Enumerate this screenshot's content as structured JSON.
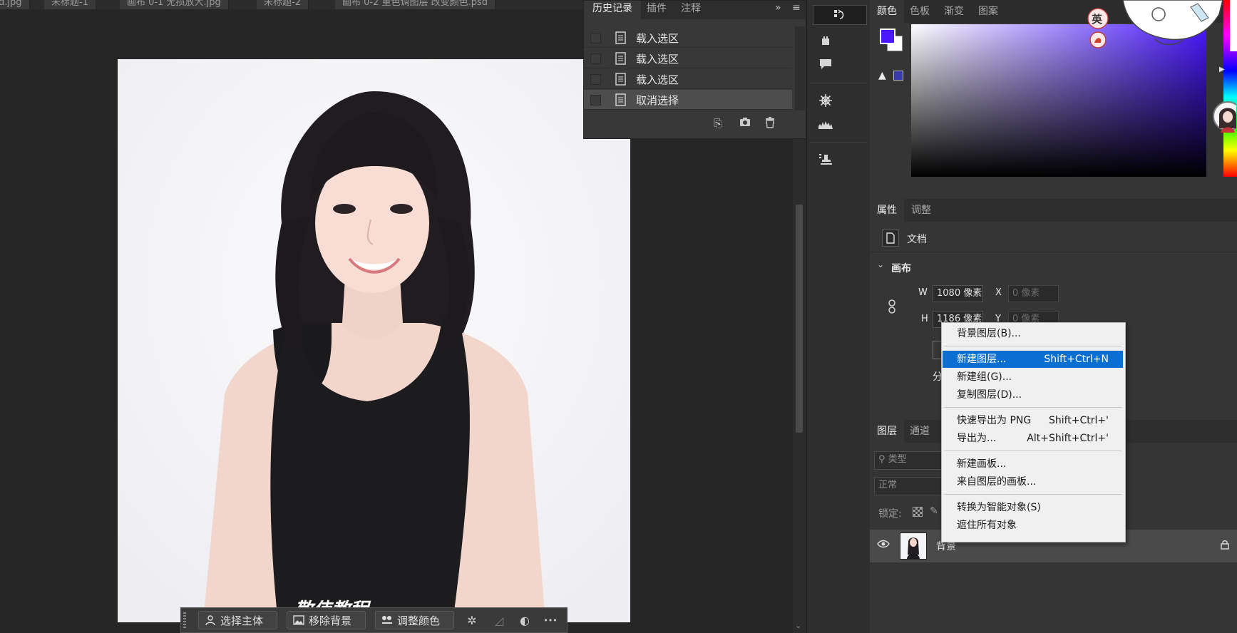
{
  "doc_tabs": [
    "d.jpg",
    "未标题-1",
    "画布 0-1 无损放大.jpg",
    "未标题-2",
    "画布 0-2 重色调图层 改变颜色.psd"
  ],
  "history": {
    "tabs": [
      "历史记录",
      "插件",
      "注释"
    ],
    "states": [
      {
        "label": "载入选区",
        "selected": false
      },
      {
        "label": "载入选区",
        "selected": false
      },
      {
        "label": "载入选区",
        "selected": false
      },
      {
        "label": "取消选择",
        "selected": true
      }
    ]
  },
  "color_panel": {
    "tabs": [
      "颜色",
      "色板",
      "渐变",
      "图案"
    ],
    "foreground": "#4a18ff",
    "background": "#ffffff",
    "ime_badge": "英"
  },
  "properties": {
    "tabs": [
      "属性",
      "调整"
    ],
    "doc_label": "文档",
    "section": "画布",
    "w_label": "W",
    "w_value": "1080 像素",
    "h_label": "H",
    "h_value": "1186 像素",
    "x_label": "X",
    "x_placeholder": "0 像素",
    "y_label": "Y",
    "y_placeholder": "0 像素",
    "partial_label": "分"
  },
  "layers": {
    "tabs": [
      "图层",
      "通道"
    ],
    "search_placeholder": "类型",
    "blend_mode": "正常",
    "lock_label": "锁定:",
    "layer_name": "背景"
  },
  "context_menu": {
    "groups": [
      [
        {
          "label": "背景图层(B)...",
          "shortcut": "",
          "highlighted": false
        }
      ],
      [
        {
          "label": "新建图层...",
          "shortcut": "Shift+Ctrl+N",
          "highlighted": true
        },
        {
          "label": "新建组(G)...",
          "shortcut": "",
          "highlighted": false
        },
        {
          "label": "复制图层(D)...",
          "shortcut": "",
          "highlighted": false
        }
      ],
      [
        {
          "label": "快速导出为 PNG",
          "shortcut": "Shift+Ctrl+'",
          "highlighted": false
        },
        {
          "label": "导出为...",
          "shortcut": "Alt+Shift+Ctrl+'",
          "highlighted": false
        }
      ],
      [
        {
          "label": "新建画板...",
          "shortcut": "",
          "highlighted": false
        },
        {
          "label": "来自图层的画板...",
          "shortcut": "",
          "highlighted": false
        }
      ],
      [
        {
          "label": "转换为智能对象(S)",
          "shortcut": "",
          "highlighted": false
        },
        {
          "label": "遮住所有对象",
          "shortcut": "",
          "highlighted": false
        }
      ]
    ]
  },
  "taskbar": {
    "select_subject": "选择主体",
    "remove_background": "移除背景",
    "adjust_color": "调整颜色",
    "more": "•••"
  },
  "watermark": "敬伟教程"
}
